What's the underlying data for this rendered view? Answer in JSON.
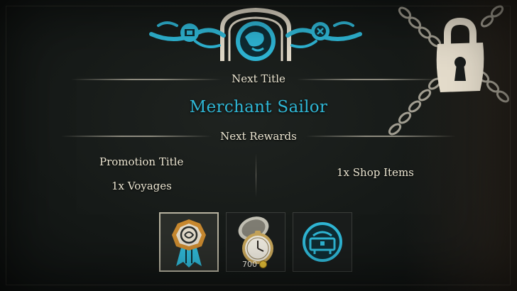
{
  "header": {
    "next_title_label": "Next Title",
    "next_title_value": "Merchant Sailor",
    "next_rewards_label": "Next Rewards"
  },
  "rewards": {
    "left": [
      "Promotion Title",
      "1x Voyages"
    ],
    "right": [
      "1x Shop Items"
    ]
  },
  "reward_slots": [
    {
      "icon": "promotion-medal-icon",
      "selected": true
    },
    {
      "icon": "pocket-watch-icon",
      "price": "700",
      "currency_icon": "gold-coin-icon"
    },
    {
      "icon": "voyage-chest-icon"
    }
  ],
  "lock_icon": "padlock-chains-icon",
  "colors": {
    "accent_blue": "#2fb7d6",
    "text_cream": "#ece6d2",
    "bone": "#e4dccb"
  }
}
